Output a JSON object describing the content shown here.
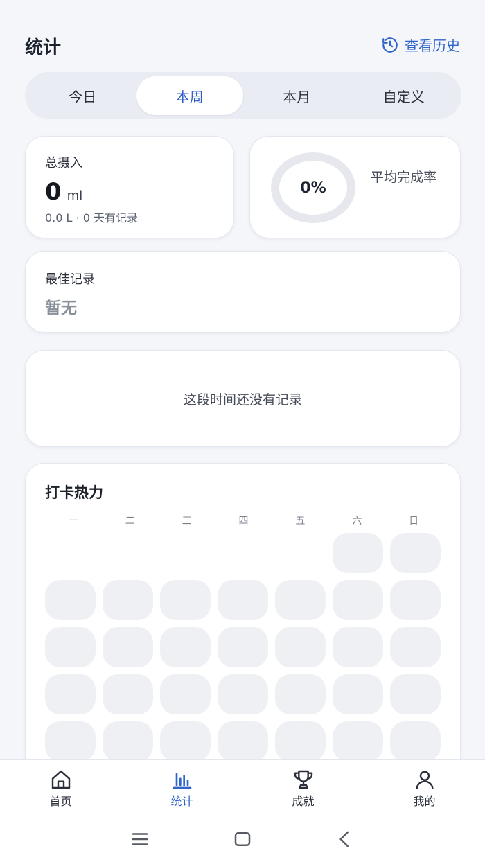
{
  "header": {
    "title": "统计",
    "history_label": "查看历史"
  },
  "tabs": [
    {
      "label": "今日",
      "active": false
    },
    {
      "label": "本周",
      "active": true
    },
    {
      "label": "本月",
      "active": false
    },
    {
      "label": "自定义",
      "active": false
    }
  ],
  "summary": {
    "total_label": "总摄入",
    "total_value": "0",
    "total_unit": "ml",
    "total_sub": "0.0 L · 0 天有记录",
    "rate_value": "0%",
    "rate_fraction": 0,
    "rate_label": "平均完成率"
  },
  "best": {
    "label": "最佳记录",
    "value": "暂无"
  },
  "empty_state": {
    "text": "这段时间还没有记录"
  },
  "heatmap": {
    "title": "打卡热力",
    "weekdays": [
      "一",
      "二",
      "三",
      "四",
      "五",
      "六",
      "日"
    ]
  },
  "bottom_nav": [
    {
      "label": "首页",
      "icon": "home-icon",
      "active": false
    },
    {
      "label": "统计",
      "icon": "bar-chart-icon",
      "active": true
    },
    {
      "label": "成就",
      "icon": "trophy-icon",
      "active": false
    },
    {
      "label": "我的",
      "icon": "user-icon",
      "active": false
    }
  ],
  "colors": {
    "accent": "#2f64c9",
    "background": "#f4f6fa",
    "card": "#ffffff",
    "ring_track": "#e6e8ed",
    "heat_cell": "#eef0f4"
  }
}
